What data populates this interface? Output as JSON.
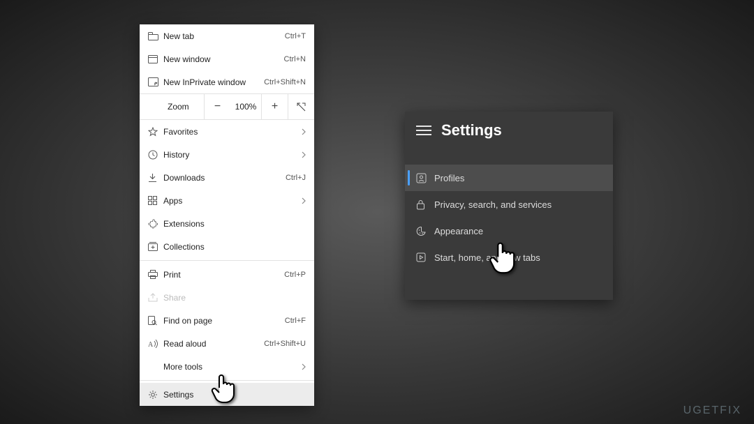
{
  "contextMenu": {
    "items": [
      {
        "icon": "new-tab-icon",
        "label": "New tab",
        "shortcut": "Ctrl+T"
      },
      {
        "icon": "window-icon",
        "label": "New window",
        "shortcut": "Ctrl+N"
      },
      {
        "icon": "inprivate-icon",
        "label": "New InPrivate window",
        "shortcut": "Ctrl+Shift+N"
      }
    ],
    "zoom": {
      "label": "Zoom",
      "value": "100%"
    },
    "items2": [
      {
        "icon": "star-icon",
        "label": "Favorites",
        "chevron": true
      },
      {
        "icon": "history-icon",
        "label": "History",
        "chevron": true
      },
      {
        "icon": "download-icon",
        "label": "Downloads",
        "shortcut": "Ctrl+J"
      },
      {
        "icon": "apps-icon",
        "label": "Apps",
        "chevron": true
      },
      {
        "icon": "extension-icon",
        "label": "Extensions"
      },
      {
        "icon": "collection-icon",
        "label": "Collections"
      }
    ],
    "items3": [
      {
        "icon": "print-icon",
        "label": "Print",
        "shortcut": "Ctrl+P"
      },
      {
        "icon": "share-icon",
        "label": "Share",
        "disabled": true
      },
      {
        "icon": "find-icon",
        "label": "Find on page",
        "shortcut": "Ctrl+F"
      },
      {
        "icon": "read-icon",
        "label": "Read aloud",
        "shortcut": "Ctrl+Shift+U"
      },
      {
        "icon": "",
        "label": "More tools",
        "chevron": true
      }
    ],
    "items4": [
      {
        "icon": "gear-icon",
        "label": "Settings",
        "highlight": true
      }
    ]
  },
  "settingsPanel": {
    "title": "Settings",
    "items": [
      {
        "icon": "profile-icon",
        "label": "Profiles",
        "active": true
      },
      {
        "icon": "lock-icon",
        "label": "Privacy, search, and services"
      },
      {
        "icon": "appearance-icon",
        "label": "Appearance"
      },
      {
        "icon": "start-icon",
        "label": "Start, home, and new tabs"
      }
    ]
  },
  "watermark": "UGETFIX"
}
